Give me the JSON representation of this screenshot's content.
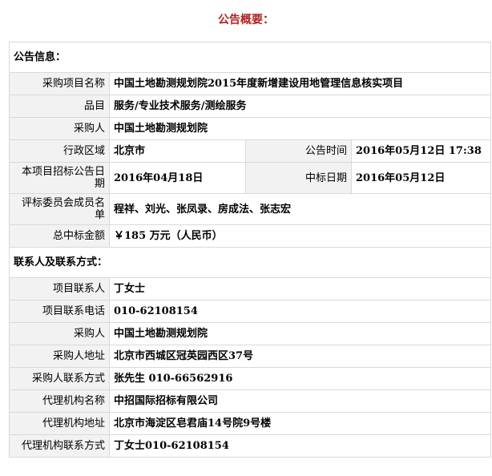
{
  "page_title": "公告概要：",
  "announcement_section": {
    "heading": "公告信息：",
    "project_name_label": "采购项目名称",
    "project_name": "中国土地勘测规划院2015年度新增建设用地管理信息核实项目",
    "category_label": "品目",
    "category": "服务/专业技术服务/测绘服务",
    "purchaser_label": "采购人",
    "purchaser": "中国土地勘测规划院",
    "region_label": "行政区域",
    "region": "北京市",
    "announce_time_label": "公告时间",
    "announce_time": "2016年05月12日  17:38",
    "tender_announce_date_label": "本项目招标公告日期",
    "tender_announce_date": "2016年04月18日",
    "award_date_label": "中标日期",
    "award_date": "2016年05月12日",
    "committee_label": "评标委员会成员名单",
    "committee": "程祥、刘光、张凤录、房成法、张志宏",
    "total_amount_label": "总中标金额",
    "total_amount": "￥185 万元（人民币）"
  },
  "contact_section": {
    "heading": "联系人及联系方式：",
    "project_contact_label": "项目联系人",
    "project_contact": "丁女士",
    "project_phone_label": "项目联系电话",
    "project_phone": "010-62108154",
    "purchaser_label": "采购人",
    "purchaser": "中国土地勘测规划院",
    "purchaser_address_label": "采购人地址",
    "purchaser_address": "北京市西城区冠英园西区37号",
    "purchaser_contact_label": "采购人联系方式",
    "purchaser_contact": "张先生  010-66562916",
    "agency_name_label": "代理机构名称",
    "agency_name": "中招国际招标有限公司",
    "agency_address_label": "代理机构地址",
    "agency_address": "北京市海淀区皂君庙14号院9号楼",
    "agency_contact_label": "代理机构联系方式",
    "agency_contact": "丁女士010-62108154"
  }
}
